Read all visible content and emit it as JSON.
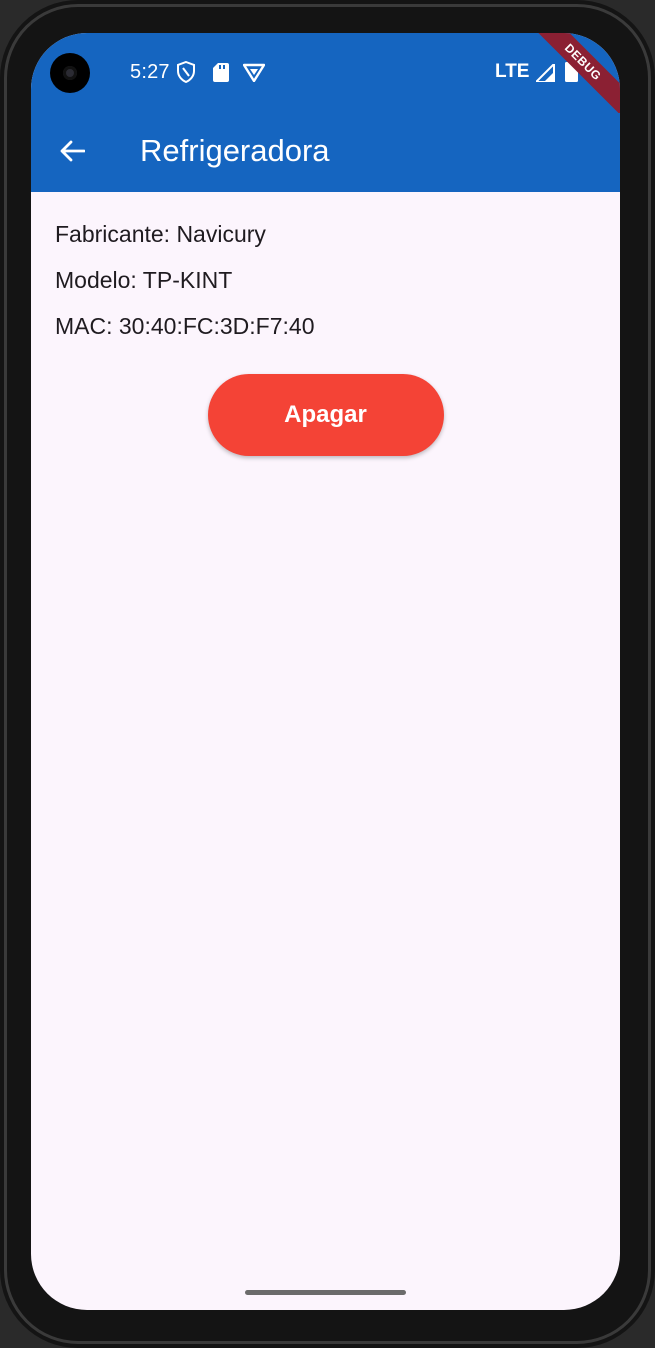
{
  "status_bar": {
    "time": "5:27",
    "network": "LTE",
    "icons": [
      "shield-icon",
      "sd-card-icon",
      "vpn-shield-icon",
      "signal-icon",
      "battery-icon"
    ]
  },
  "app_bar": {
    "title": "Refrigeradora",
    "back_icon": "arrow-back-icon",
    "color": "#1565c0"
  },
  "debug_banner": "DEBUG",
  "device": {
    "manufacturer_line": "Fabricante: Navicury",
    "model_line": "Modelo: TP-KINT",
    "mac_line": "MAC: 30:40:FC:3D:F7:40"
  },
  "action_button": {
    "label": "Apagar",
    "color": "#f44336"
  }
}
